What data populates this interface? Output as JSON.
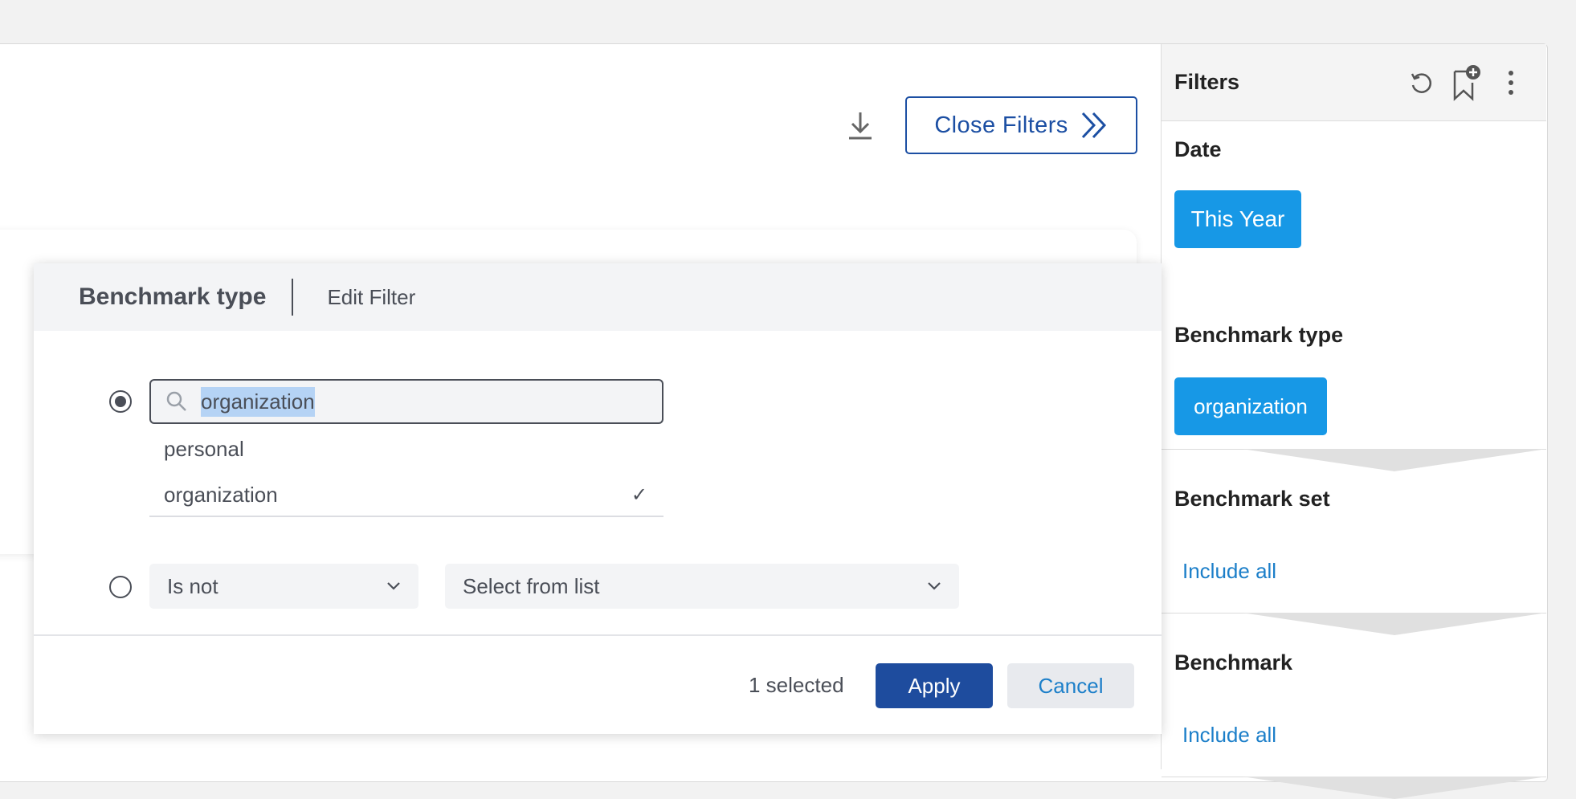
{
  "toolbar": {
    "download_icon": "download-icon",
    "close_filters_label": "Close Filters",
    "close_filters_icon": "double-chevron-right-icon"
  },
  "filters_panel": {
    "title": "Filters",
    "header_icons": [
      "reset-icon",
      "bookmark-add-icon",
      "more-vertical-icon"
    ],
    "date": {
      "label": "Date",
      "chip": "This Year"
    },
    "benchmark_type": {
      "label": "Benchmark type",
      "chip": "organization"
    },
    "benchmark_set": {
      "label": "Benchmark set",
      "link": "Include all"
    },
    "benchmark": {
      "label": "Benchmark",
      "link": "Include all"
    }
  },
  "popover": {
    "title": "Benchmark type",
    "subtitle": "Edit Filter",
    "search": {
      "value": "organization",
      "icon": "search-icon"
    },
    "options": [
      {
        "label": "personal",
        "selected": false
      },
      {
        "label": "organization",
        "selected": true,
        "check": "✓"
      }
    ],
    "operator_select": {
      "value": "Is not"
    },
    "list_select": {
      "placeholder": "Select from list"
    },
    "selected_count": "1 selected",
    "apply_label": "Apply",
    "cancel_label": "Cancel"
  },
  "colors": {
    "primary_dark": "#1e4c9e",
    "chip_blue": "#1798e6",
    "link_blue": "#1c7fc9",
    "outline_blue": "#1c4fa3"
  }
}
